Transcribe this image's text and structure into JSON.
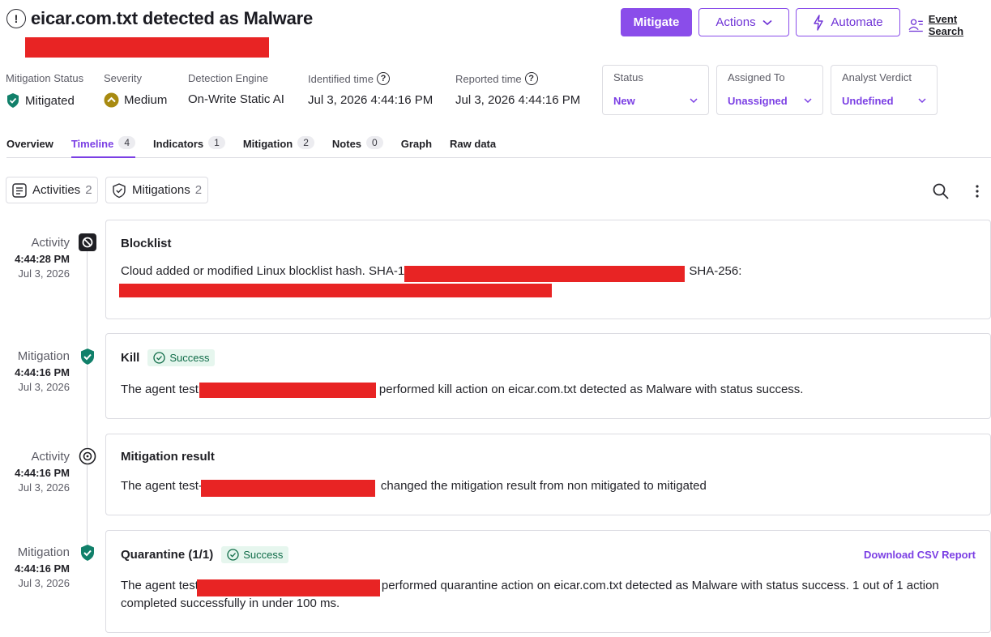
{
  "header": {
    "title": "eicar.com.txt detected as Malware",
    "buttons": {
      "mitigate": "Mitigate",
      "actions": "Actions",
      "automate": "Automate",
      "event_search": "Event Search"
    }
  },
  "meta": {
    "mitigation_status": {
      "label": "Mitigation Status",
      "value": "Mitigated"
    },
    "severity": {
      "label": "Severity",
      "value": "Medium"
    },
    "detection_engine": {
      "label": "Detection Engine",
      "value": "On-Write Static AI"
    },
    "identified_time": {
      "label": "Identified time",
      "value": "Jul 3, 2026 4:44:16 PM"
    },
    "reported_time": {
      "label": "Reported time",
      "value": "Jul 3, 2026 4:44:16 PM"
    }
  },
  "dropdowns": {
    "status": {
      "label": "Status",
      "value": "New"
    },
    "assigned_to": {
      "label": "Assigned To",
      "value": "Unassigned"
    },
    "analyst_verdict": {
      "label": "Analyst Verdict",
      "value": "Undefined"
    }
  },
  "tabs": [
    {
      "label": "Overview",
      "count": null
    },
    {
      "label": "Timeline",
      "count": "4"
    },
    {
      "label": "Indicators",
      "count": "1"
    },
    {
      "label": "Mitigation",
      "count": "2"
    },
    {
      "label": "Notes",
      "count": "0"
    },
    {
      "label": "Graph",
      "count": null
    },
    {
      "label": "Raw data",
      "count": null
    }
  ],
  "filters": {
    "activities": {
      "label": "Activities",
      "count": "2"
    },
    "mitigations": {
      "label": "Mitigations",
      "count": "2"
    }
  },
  "timeline": [
    {
      "type": "Activity",
      "time": "4:44:28 PM",
      "date": "Jul 3, 2026",
      "title": "Blocklist",
      "body_a": "Cloud added or modified Linux blocklist hash. SHA-1:",
      "body_b": "SHA-256:"
    },
    {
      "type": "Mitigation",
      "time": "4:44:16 PM",
      "date": "Jul 3, 2026",
      "title": "Kill",
      "badge": "Success",
      "body_a": "The agent test",
      "body_b": "performed kill action on eicar.com.txt detected as Malware with status success."
    },
    {
      "type": "Activity",
      "time": "4:44:16 PM",
      "date": "Jul 3, 2026",
      "title": "Mitigation result",
      "body_a": "The agent test-",
      "body_b": "changed the mitigation result from non mitigated to mitigated"
    },
    {
      "type": "Mitigation",
      "time": "4:44:16 PM",
      "date": "Jul 3, 2026",
      "title": "Quarantine (1/1)",
      "badge": "Success",
      "link": "Download CSV Report",
      "body_a": "The agent test",
      "body_b": "performed quarantine action on eicar.com.txt detected as Malware with status success. 1 out of 1 action",
      "body_c": "completed successfully in under 100 ms."
    }
  ]
}
